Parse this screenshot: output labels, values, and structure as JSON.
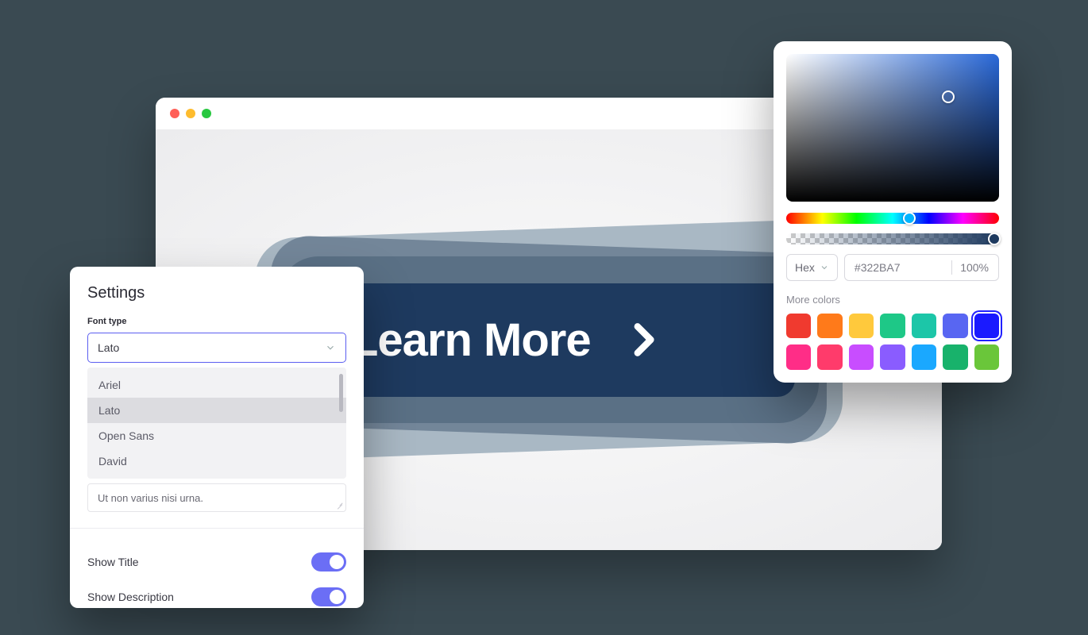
{
  "browser": {
    "cta_text": "Learn More"
  },
  "settings": {
    "title": "Settings",
    "font_type_label": "Font type",
    "font_selected": "Lato",
    "font_options": [
      "Ariel",
      "Lato",
      "Open Sans",
      "David"
    ],
    "preview_text": "Ut non varius nisi urna.",
    "toggles": [
      {
        "label": "Show Title",
        "on": true
      },
      {
        "label": "Show Description",
        "on": true
      }
    ]
  },
  "color_picker": {
    "format_label": "Hex",
    "hex_value": "#322BA7",
    "opacity": "100%",
    "more_colors_label": "More colors",
    "swatches": [
      "#f03a2f",
      "#ff7a1a",
      "#ffc93c",
      "#1ec887",
      "#1cc6a8",
      "#5866f2",
      "#1a1aff",
      "#ff2d87",
      "#ff3b6b",
      "#c84dff",
      "#8a5cff",
      "#1aa8ff",
      "#18b26b",
      "#6ac63a"
    ],
    "selected_swatch_index": 6
  }
}
